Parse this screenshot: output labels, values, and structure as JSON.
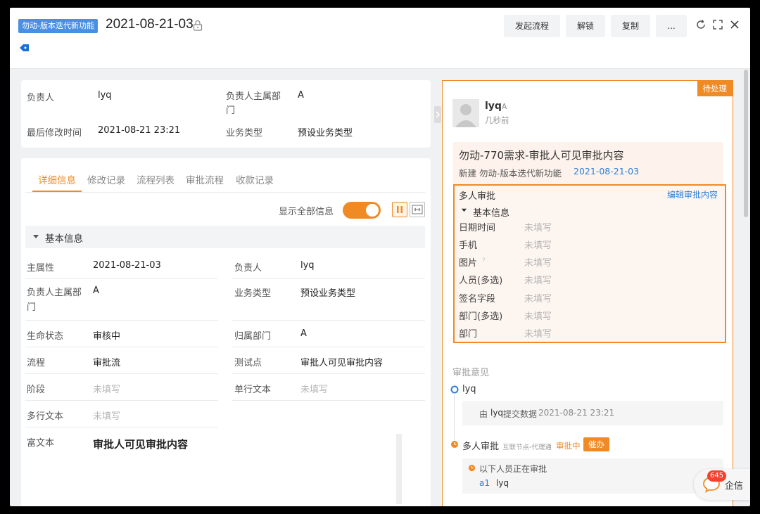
{
  "header": {
    "tag": "勿动-版本迭代新功能",
    "title": "2021-08-21-03",
    "buttons": {
      "start_flow": "发起流程",
      "unlock": "解锁",
      "copy": "复制",
      "more": "..."
    }
  },
  "summary": {
    "owner_label": "负责人",
    "owner_value": "lyq",
    "dept_label": "负责人主属部门",
    "dept_value": "A",
    "modified_label": "最后修改时间",
    "modified_value": "2021-08-21 23:21",
    "biztype_label": "业务类型",
    "biztype_value": "预设业务类型"
  },
  "tabs": [
    "详细信息",
    "修改记录",
    "流程列表",
    "审批流程",
    "收款记录"
  ],
  "show_all_label": "显示全部信息",
  "section_title": "基本信息",
  "fields": {
    "owner_attr_label": "主属性",
    "owner_attr_value": "2021-08-21-03",
    "owner_label": "负责人",
    "owner_value": "lyq",
    "dept_label": "负责人主属部门",
    "dept_value": "A",
    "biztype_label": "业务类型",
    "biztype_value": "预设业务类型",
    "lifecycle_label": "生命状态",
    "lifecycle_value": "审核中",
    "belong_dept_label": "归属部门",
    "belong_dept_value": "A",
    "flow_label": "流程",
    "flow_value": "审批流",
    "test_label": "测试点",
    "test_value": "审批人可见审批内容",
    "stage_label": "阶段",
    "stage_value": "未填写",
    "single_text_label": "单行文本",
    "single_text_value": "未填写",
    "multi_text_label": "多行文本",
    "multi_text_value": "未填写",
    "rich_text_label": "富文本",
    "rich_text_value": "审批人可见审批内容"
  },
  "right": {
    "pending": "待处理",
    "user": "lyq",
    "user_tag": "A",
    "time_ago": "几秒前",
    "req_title": "勿动-770需求-审批人可见审批内容",
    "req_sub_prefix": "新建 勿动-版本迭代新功能",
    "req_sub_link": "2021-08-21-03",
    "approve_title": "多人审批",
    "edit_content": "编辑审批内容",
    "basic_info": "基本信息",
    "rows": [
      {
        "label": "日期时间",
        "value": "未填写"
      },
      {
        "label": "手机",
        "value": "未填写"
      },
      {
        "label": "图片",
        "value": "未填写"
      },
      {
        "label": "人员(多选)",
        "value": "未填写"
      },
      {
        "label": "签名字段",
        "value": "未填写"
      },
      {
        "label": "部门(多选)",
        "value": "未填写"
      },
      {
        "label": "部门",
        "value": "未填写"
      }
    ],
    "opinion_title": "审批意见",
    "timeline_user": "lyq",
    "submit_prefix": "由",
    "submit_user": "lyq",
    "submit_action": "提交数据",
    "submit_time": "2021-08-21 23:21",
    "multi_title": "多人审批",
    "multi_sub": "互联节点-代理通",
    "multi_status": "审批中",
    "urge": "催办",
    "approving_note": "以下人员正在审批",
    "approver_code": "a1",
    "approver_name": "lyq"
  },
  "im": {
    "badge": "645",
    "label": "企信"
  }
}
